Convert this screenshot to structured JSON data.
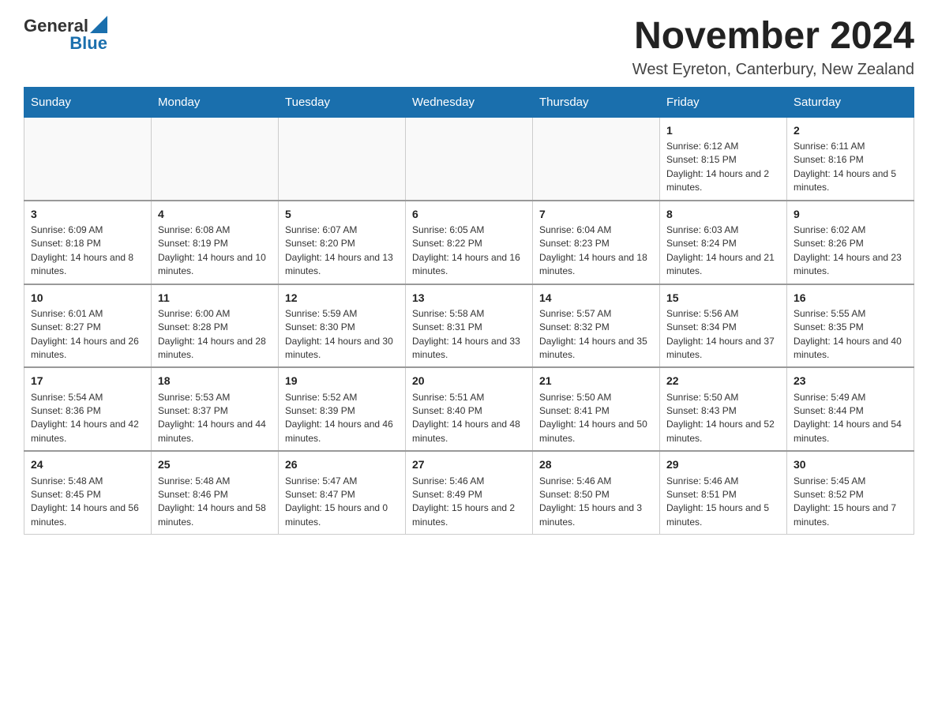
{
  "header": {
    "logo_general": "General",
    "logo_blue": "Blue",
    "month_title": "November 2024",
    "location": "West Eyreton, Canterbury, New Zealand"
  },
  "weekdays": [
    "Sunday",
    "Monday",
    "Tuesday",
    "Wednesday",
    "Thursday",
    "Friday",
    "Saturday"
  ],
  "weeks": [
    {
      "days": [
        {
          "num": "",
          "empty": true
        },
        {
          "num": "",
          "empty": true
        },
        {
          "num": "",
          "empty": true
        },
        {
          "num": "",
          "empty": true
        },
        {
          "num": "",
          "empty": true
        },
        {
          "num": "1",
          "sunrise": "Sunrise: 6:12 AM",
          "sunset": "Sunset: 8:15 PM",
          "daylight": "Daylight: 14 hours and 2 minutes."
        },
        {
          "num": "2",
          "sunrise": "Sunrise: 6:11 AM",
          "sunset": "Sunset: 8:16 PM",
          "daylight": "Daylight: 14 hours and 5 minutes."
        }
      ]
    },
    {
      "days": [
        {
          "num": "3",
          "sunrise": "Sunrise: 6:09 AM",
          "sunset": "Sunset: 8:18 PM",
          "daylight": "Daylight: 14 hours and 8 minutes."
        },
        {
          "num": "4",
          "sunrise": "Sunrise: 6:08 AM",
          "sunset": "Sunset: 8:19 PM",
          "daylight": "Daylight: 14 hours and 10 minutes."
        },
        {
          "num": "5",
          "sunrise": "Sunrise: 6:07 AM",
          "sunset": "Sunset: 8:20 PM",
          "daylight": "Daylight: 14 hours and 13 minutes."
        },
        {
          "num": "6",
          "sunrise": "Sunrise: 6:05 AM",
          "sunset": "Sunset: 8:22 PM",
          "daylight": "Daylight: 14 hours and 16 minutes."
        },
        {
          "num": "7",
          "sunrise": "Sunrise: 6:04 AM",
          "sunset": "Sunset: 8:23 PM",
          "daylight": "Daylight: 14 hours and 18 minutes."
        },
        {
          "num": "8",
          "sunrise": "Sunrise: 6:03 AM",
          "sunset": "Sunset: 8:24 PM",
          "daylight": "Daylight: 14 hours and 21 minutes."
        },
        {
          "num": "9",
          "sunrise": "Sunrise: 6:02 AM",
          "sunset": "Sunset: 8:26 PM",
          "daylight": "Daylight: 14 hours and 23 minutes."
        }
      ]
    },
    {
      "days": [
        {
          "num": "10",
          "sunrise": "Sunrise: 6:01 AM",
          "sunset": "Sunset: 8:27 PM",
          "daylight": "Daylight: 14 hours and 26 minutes."
        },
        {
          "num": "11",
          "sunrise": "Sunrise: 6:00 AM",
          "sunset": "Sunset: 8:28 PM",
          "daylight": "Daylight: 14 hours and 28 minutes."
        },
        {
          "num": "12",
          "sunrise": "Sunrise: 5:59 AM",
          "sunset": "Sunset: 8:30 PM",
          "daylight": "Daylight: 14 hours and 30 minutes."
        },
        {
          "num": "13",
          "sunrise": "Sunrise: 5:58 AM",
          "sunset": "Sunset: 8:31 PM",
          "daylight": "Daylight: 14 hours and 33 minutes."
        },
        {
          "num": "14",
          "sunrise": "Sunrise: 5:57 AM",
          "sunset": "Sunset: 8:32 PM",
          "daylight": "Daylight: 14 hours and 35 minutes."
        },
        {
          "num": "15",
          "sunrise": "Sunrise: 5:56 AM",
          "sunset": "Sunset: 8:34 PM",
          "daylight": "Daylight: 14 hours and 37 minutes."
        },
        {
          "num": "16",
          "sunrise": "Sunrise: 5:55 AM",
          "sunset": "Sunset: 8:35 PM",
          "daylight": "Daylight: 14 hours and 40 minutes."
        }
      ]
    },
    {
      "days": [
        {
          "num": "17",
          "sunrise": "Sunrise: 5:54 AM",
          "sunset": "Sunset: 8:36 PM",
          "daylight": "Daylight: 14 hours and 42 minutes."
        },
        {
          "num": "18",
          "sunrise": "Sunrise: 5:53 AM",
          "sunset": "Sunset: 8:37 PM",
          "daylight": "Daylight: 14 hours and 44 minutes."
        },
        {
          "num": "19",
          "sunrise": "Sunrise: 5:52 AM",
          "sunset": "Sunset: 8:39 PM",
          "daylight": "Daylight: 14 hours and 46 minutes."
        },
        {
          "num": "20",
          "sunrise": "Sunrise: 5:51 AM",
          "sunset": "Sunset: 8:40 PM",
          "daylight": "Daylight: 14 hours and 48 minutes."
        },
        {
          "num": "21",
          "sunrise": "Sunrise: 5:50 AM",
          "sunset": "Sunset: 8:41 PM",
          "daylight": "Daylight: 14 hours and 50 minutes."
        },
        {
          "num": "22",
          "sunrise": "Sunrise: 5:50 AM",
          "sunset": "Sunset: 8:43 PM",
          "daylight": "Daylight: 14 hours and 52 minutes."
        },
        {
          "num": "23",
          "sunrise": "Sunrise: 5:49 AM",
          "sunset": "Sunset: 8:44 PM",
          "daylight": "Daylight: 14 hours and 54 minutes."
        }
      ]
    },
    {
      "days": [
        {
          "num": "24",
          "sunrise": "Sunrise: 5:48 AM",
          "sunset": "Sunset: 8:45 PM",
          "daylight": "Daylight: 14 hours and 56 minutes."
        },
        {
          "num": "25",
          "sunrise": "Sunrise: 5:48 AM",
          "sunset": "Sunset: 8:46 PM",
          "daylight": "Daylight: 14 hours and 58 minutes."
        },
        {
          "num": "26",
          "sunrise": "Sunrise: 5:47 AM",
          "sunset": "Sunset: 8:47 PM",
          "daylight": "Daylight: 15 hours and 0 minutes."
        },
        {
          "num": "27",
          "sunrise": "Sunrise: 5:46 AM",
          "sunset": "Sunset: 8:49 PM",
          "daylight": "Daylight: 15 hours and 2 minutes."
        },
        {
          "num": "28",
          "sunrise": "Sunrise: 5:46 AM",
          "sunset": "Sunset: 8:50 PM",
          "daylight": "Daylight: 15 hours and 3 minutes."
        },
        {
          "num": "29",
          "sunrise": "Sunrise: 5:46 AM",
          "sunset": "Sunset: 8:51 PM",
          "daylight": "Daylight: 15 hours and 5 minutes."
        },
        {
          "num": "30",
          "sunrise": "Sunrise: 5:45 AM",
          "sunset": "Sunset: 8:52 PM",
          "daylight": "Daylight: 15 hours and 7 minutes."
        }
      ]
    }
  ]
}
